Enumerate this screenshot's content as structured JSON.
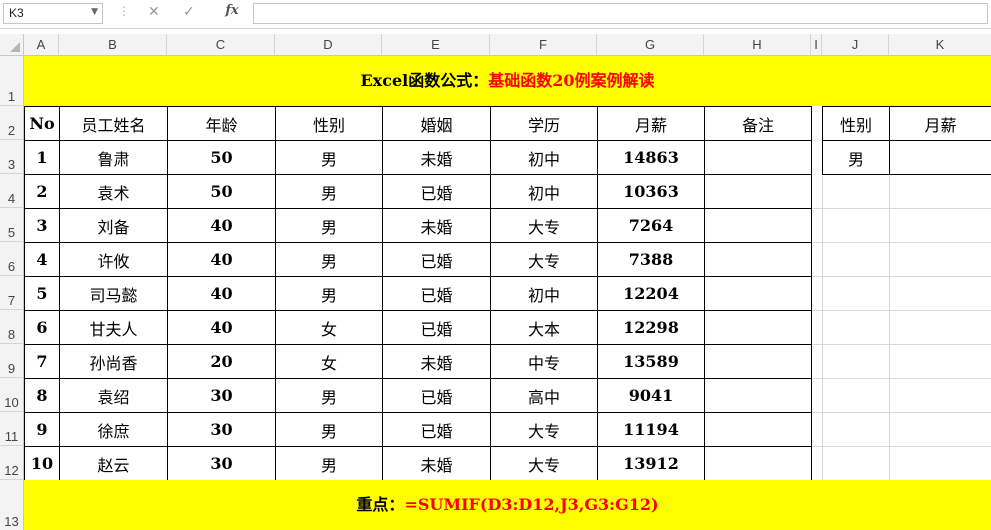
{
  "formula_bar": {
    "name_box": "K3",
    "cancel_icon": "✕",
    "enter_icon": "✓",
    "fx_label": "fx",
    "formula": ""
  },
  "columns": [
    "A",
    "B",
    "C",
    "D",
    "E",
    "F",
    "G",
    "H",
    "I",
    "J",
    "K"
  ],
  "rows": [
    "1",
    "2",
    "3",
    "4",
    "5",
    "6",
    "7",
    "8",
    "9",
    "10",
    "11",
    "12",
    "13"
  ],
  "title": {
    "prefix": "Excel函数公式：",
    "highlight": "基础函数20例案例解读"
  },
  "footer": {
    "prefix": "重点：",
    "formula": "=SUMIF(D3:D12,J3,G3:G12)"
  },
  "table": {
    "headers": [
      "No",
      "员工姓名",
      "年龄",
      "性别",
      "婚姻",
      "学历",
      "月薪",
      "备注"
    ],
    "rows": [
      [
        "1",
        "鲁肃",
        "50",
        "男",
        "未婚",
        "初中",
        "14863",
        ""
      ],
      [
        "2",
        "袁术",
        "50",
        "男",
        "已婚",
        "初中",
        "10363",
        ""
      ],
      [
        "3",
        "刘备",
        "40",
        "男",
        "未婚",
        "大专",
        "7264",
        ""
      ],
      [
        "4",
        "许攸",
        "40",
        "男",
        "已婚",
        "大专",
        "7388",
        ""
      ],
      [
        "5",
        "司马懿",
        "40",
        "男",
        "已婚",
        "初中",
        "12204",
        ""
      ],
      [
        "6",
        "甘夫人",
        "40",
        "女",
        "已婚",
        "大本",
        "12298",
        ""
      ],
      [
        "7",
        "孙尚香",
        "20",
        "女",
        "未婚",
        "中专",
        "13589",
        ""
      ],
      [
        "8",
        "袁绍",
        "30",
        "男",
        "已婚",
        "高中",
        "9041",
        ""
      ],
      [
        "9",
        "徐庶",
        "30",
        "男",
        "已婚",
        "大专",
        "11194",
        ""
      ],
      [
        "10",
        "赵云",
        "30",
        "男",
        "未婚",
        "大专",
        "13912",
        ""
      ]
    ]
  },
  "side_table": {
    "headers": [
      "性别",
      "月薪"
    ],
    "row": [
      "男",
      ""
    ]
  },
  "colors": {
    "band": "#ffff00",
    "accent_red": "#ff0000",
    "header_bg": "#f3f3f3"
  }
}
